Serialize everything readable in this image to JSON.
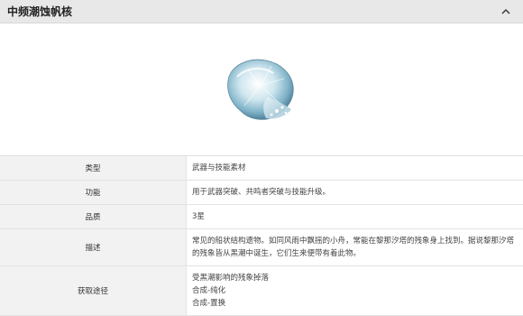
{
  "header": {
    "title": "中频潮蚀帆核"
  },
  "rows": [
    {
      "label": "类型",
      "value": "武器与技能素材"
    },
    {
      "label": "功能",
      "value": "用于武器突破、共鸣者突破与技能升级。"
    },
    {
      "label": "品质",
      "value": "3星"
    },
    {
      "label": "描述",
      "value": "常见的船状结构遗物。如同风雨中飘摇的小舟，常能在黎那汐塔的残象身上找到。据说黎那汐塔的残象皆从黑潮中诞生，它们生来便带有着此物。"
    },
    {
      "label": "获取途径",
      "lines": [
        "受黑潮影响的残象掉落",
        "合成-纯化",
        "合成-置换"
      ]
    }
  ],
  "colors": {
    "header_bg": "#e8e8e8",
    "label_bg": "#f2f2f2",
    "border": "#e3e3e3"
  },
  "icons": {
    "header_toggle": "chevron-up-icon",
    "item_image": "shell-crystal-item"
  }
}
